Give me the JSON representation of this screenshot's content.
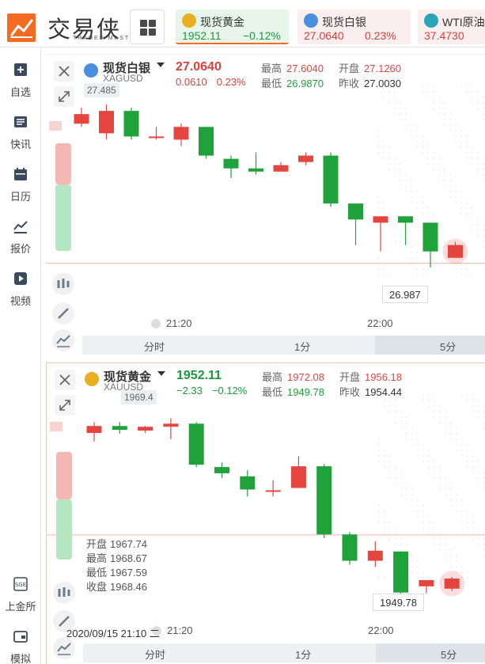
{
  "app": {
    "logo_text": "交易侠",
    "logo_sub": "TRADER MASTER",
    "accent": "#f26b21"
  },
  "tickers": [
    {
      "name": "现货黄金",
      "price": "1952.11",
      "change": "−0.12%",
      "color": "#1a9a3b",
      "bg": "#e7f5ea",
      "icon": "gold-coin-icon",
      "icon_color": "#e8b020",
      "selected": true
    },
    {
      "name": "现货白银",
      "price": "27.0640",
      "change": "0.23%",
      "color": "#e0403c",
      "bg": "#fbeeee",
      "icon": "silver-coin-icon",
      "icon_color": "#4a8ee0",
      "selected": false
    },
    {
      "name": "WTI原油",
      "price": "37.4730",
      "change": "",
      "color": "#e0403c",
      "bg": "#fbeeee",
      "icon": "oil-barrel-icon",
      "icon_color": "#2aa5b8",
      "selected": false
    }
  ],
  "sidebar": {
    "items": [
      {
        "label": "自选",
        "icon": "plus-square-icon"
      },
      {
        "label": "快讯",
        "icon": "news-icon"
      },
      {
        "label": "日历",
        "icon": "calendar-icon"
      },
      {
        "label": "报价",
        "icon": "trend-line-icon"
      },
      {
        "label": "视频",
        "icon": "play-icon"
      }
    ],
    "bottom_items": [
      {
        "label": "上金所",
        "icon": "sge-icon"
      },
      {
        "label": "模拟",
        "icon": "wallet-icon"
      }
    ]
  },
  "panels": [
    {
      "name": "现货白银",
      "code": "XAGUSD",
      "price": "27.0640",
      "change": "0.0610",
      "change_pct": "0.23%",
      "price_color": "#e0403c",
      "stats": {
        "high_label": "最高",
        "high": "27.6040",
        "open_label": "开盘",
        "open": "27.1260",
        "low_label": "最低",
        "low": "26.9870",
        "prev_label": "昨收",
        "prev": "27.0030"
      },
      "crosshair_value": "27.485",
      "low_tag": "26.987",
      "time_labels": [
        "21:20",
        "22:00"
      ],
      "intervals": [
        "分时",
        "1分",
        "5分"
      ],
      "selected_interval": "5分",
      "chart_data": {
        "type": "candlestick",
        "ylim": [
          26.95,
          27.52
        ],
        "candles": [
          {
            "o": 27.44,
            "h": 27.49,
            "l": 27.43,
            "c": 27.47
          },
          {
            "o": 27.41,
            "h": 27.5,
            "l": 27.39,
            "c": 27.48
          },
          {
            "o": 27.48,
            "h": 27.49,
            "l": 27.39,
            "c": 27.4
          },
          {
            "o": 27.4,
            "h": 27.43,
            "l": 27.39,
            "c": 27.4
          },
          {
            "o": 27.39,
            "h": 27.44,
            "l": 27.37,
            "c": 27.43
          },
          {
            "o": 27.43,
            "h": 27.43,
            "l": 27.33,
            "c": 27.34
          },
          {
            "o": 27.33,
            "h": 27.34,
            "l": 27.27,
            "c": 27.3
          },
          {
            "o": 27.3,
            "h": 27.35,
            "l": 27.28,
            "c": 27.29
          },
          {
            "o": 27.29,
            "h": 27.32,
            "l": 27.29,
            "c": 27.31
          },
          {
            "o": 27.32,
            "h": 27.35,
            "l": 27.31,
            "c": 27.34
          },
          {
            "o": 27.34,
            "h": 27.35,
            "l": 27.18,
            "c": 27.19
          },
          {
            "o": 27.19,
            "h": 27.18,
            "l": 27.06,
            "c": 27.14
          },
          {
            "o": 27.13,
            "h": 27.14,
            "l": 27.04,
            "c": 27.15
          },
          {
            "o": 27.15,
            "h": 27.15,
            "l": 27.06,
            "c": 27.13
          },
          {
            "o": 27.13,
            "h": 27.12,
            "l": 26.99,
            "c": 27.04
          },
          {
            "o": 27.02,
            "h": 27.07,
            "l": 27.02,
            "c": 27.06
          }
        ]
      }
    },
    {
      "name": "现货黄金",
      "code": "XAUUSD",
      "price": "1952.11",
      "change": "−2.33",
      "change_pct": "−0.12%",
      "price_color": "#1a9a3b",
      "stats": {
        "high_label": "最高",
        "high": "1972.08",
        "open_label": "开盘",
        "open": "1956.18",
        "low_label": "最低",
        "low": "1949.78",
        "prev_label": "昨收",
        "prev": "1954.44"
      },
      "crosshair_value": "1969.4",
      "low_tag": "1949.78",
      "time_labels": [
        "21:20",
        "22:00"
      ],
      "intervals": [
        "分时",
        "1分",
        "5分"
      ],
      "selected_interval": "5分",
      "ohlc": {
        "open_label": "开盘",
        "open": "1967.74",
        "high_label": "最高",
        "high": "1968.67",
        "low_label": "最低",
        "low": "1967.59",
        "close_label": "收盘",
        "close": "1968.46"
      },
      "date_readout": "2020/09/15 21:10 二",
      "chart_data": {
        "type": "candlestick",
        "ylim": [
          1948.5,
          1972.0
        ],
        "candles": [
          {
            "o": 1967.6,
            "h": 1969.0,
            "l": 1966.5,
            "c": 1968.5
          },
          {
            "o": 1968.5,
            "h": 1969.0,
            "l": 1967.5,
            "c": 1968.0
          },
          {
            "o": 1967.9,
            "h": 1968.5,
            "l": 1967.6,
            "c": 1968.4
          },
          {
            "o": 1968.4,
            "h": 1969.5,
            "l": 1966.8,
            "c": 1968.8
          },
          {
            "o": 1968.8,
            "h": 1969.0,
            "l": 1963.2,
            "c": 1963.5
          },
          {
            "o": 1963.2,
            "h": 1963.8,
            "l": 1961.8,
            "c": 1962.4
          },
          {
            "o": 1962.0,
            "h": 1962.8,
            "l": 1959.4,
            "c": 1960.3
          },
          {
            "o": 1960.2,
            "h": 1961.5,
            "l": 1959.4,
            "c": 1960.2
          },
          {
            "o": 1960.5,
            "h": 1964.6,
            "l": 1960.5,
            "c": 1963.3
          },
          {
            "o": 1963.3,
            "h": 1963.6,
            "l": 1954.0,
            "c": 1954.5
          },
          {
            "o": 1954.5,
            "h": 1954.8,
            "l": 1950.6,
            "c": 1951.1
          },
          {
            "o": 1951.1,
            "h": 1953.6,
            "l": 1950.3,
            "c": 1952.4
          },
          {
            "o": 1952.3,
            "h": 1952.3,
            "l": 1945.5,
            "c": 1947.0
          },
          {
            "o": 1947.8,
            "h": 1948.6,
            "l": 1946.9,
            "c": 1948.6
          },
          {
            "o": 1947.5,
            "h": 1949.0,
            "l": 1947.2,
            "c": 1948.8
          }
        ]
      }
    }
  ],
  "colors": {
    "up": "#e5453f",
    "down": "#1fa23a",
    "neutral": "#ededed"
  }
}
